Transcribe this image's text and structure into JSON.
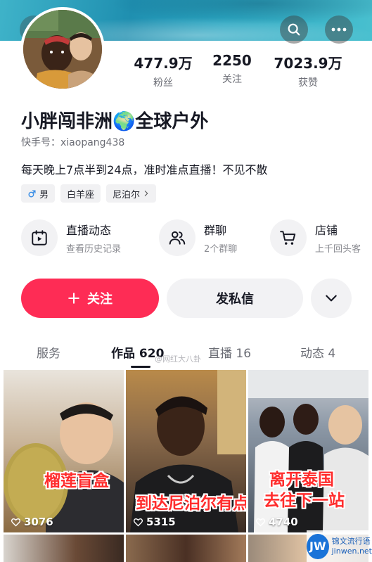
{
  "profile": {
    "nickname": "小胖闯非洲🌍全球户外",
    "handle_label": "快手号：",
    "handle": "xiaopang438",
    "bio": "每天晚上7点半到24点，准时准点直播！不见不散"
  },
  "stats": [
    {
      "value": "477.9万",
      "label": "粉丝"
    },
    {
      "value": "2250",
      "label": "关注"
    },
    {
      "value": "7023.9万",
      "label": "获赞"
    }
  ],
  "tags": [
    {
      "icon": "male-icon",
      "label": "男"
    },
    {
      "label": "白羊座"
    },
    {
      "label": "尼泊尔"
    }
  ],
  "services": [
    {
      "icon": "live-calendar-icon",
      "title": "直播动态",
      "subtitle": "查看历史记录"
    },
    {
      "icon": "group-chat-icon",
      "title": "群聊",
      "subtitle": "2个群聊"
    },
    {
      "icon": "cart-icon",
      "title": "店铺",
      "subtitle": "上千回头客"
    }
  ],
  "actions": {
    "follow": "关注",
    "message": "发私信"
  },
  "tabs": [
    {
      "label": "服务"
    },
    {
      "label": "作品 620"
    },
    {
      "label": "直播 16"
    },
    {
      "label": "动态 4"
    }
  ],
  "watermark": "@网红大八卦",
  "videos": [
    {
      "caption": "榴莲盲盒",
      "likes": "3076"
    },
    {
      "caption": "到达尼泊尔有点冷",
      "likes": "5315"
    },
    {
      "caption_line1": "离开泰国",
      "caption_line2": "去往下一站",
      "likes": "4740"
    }
  ],
  "logo": {
    "mark": "JW",
    "line1": "锦文流行语",
    "line2": "jinwen.net"
  },
  "colors": {
    "accent": "#fe2c55",
    "caption": "#ff2d2d"
  }
}
